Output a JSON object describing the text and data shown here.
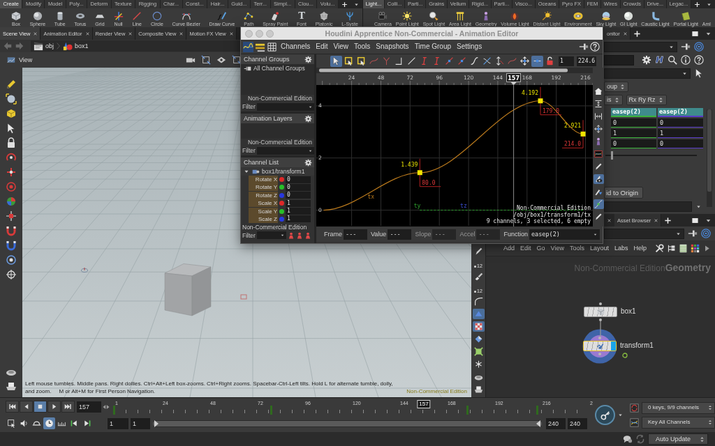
{
  "shelves": [
    {
      "tabs": [
        {
          "label": "Create",
          "selected": true
        },
        {
          "label": "Modify",
          "selected": false
        },
        {
          "label": "Model",
          "selected": false
        },
        {
          "label": "Poly...",
          "selected": false
        },
        {
          "label": "Deform",
          "selected": false
        },
        {
          "label": "Texture",
          "selected": false
        },
        {
          "label": "Rigging",
          "selected": false
        },
        {
          "label": "Char...",
          "selected": false
        },
        {
          "label": "Const...",
          "selected": false
        },
        {
          "label": "Hair...",
          "selected": false
        },
        {
          "label": "Guid...",
          "selected": false
        },
        {
          "label": "Terr...",
          "selected": false
        },
        {
          "label": "Simpl...",
          "selected": false
        },
        {
          "label": "Clou...",
          "selected": false
        },
        {
          "label": "Volu...",
          "selected": false
        }
      ],
      "tools": [
        {
          "label": "Box"
        },
        {
          "label": "Sphere"
        },
        {
          "label": "Tube"
        },
        {
          "label": "Torus"
        },
        {
          "label": "Grid"
        },
        {
          "label": "Null"
        },
        {
          "label": "Line"
        },
        {
          "label": "Circle"
        },
        {
          "label": "Curve Bezier"
        },
        {
          "label": "Draw Curve"
        },
        {
          "label": "Path"
        },
        {
          "label": "Spray Paint"
        },
        {
          "label": "Font",
          "glyph": "T"
        },
        {
          "label": "Platonic"
        },
        {
          "label": "L-Syste"
        }
      ]
    },
    {
      "tabs": [
        {
          "label": "Light...",
          "selected": true
        },
        {
          "label": "Colli...",
          "selected": false
        },
        {
          "label": "Parti...",
          "selected": false
        },
        {
          "label": "Grains",
          "selected": false
        },
        {
          "label": "Vellum",
          "selected": false
        },
        {
          "label": "Rigid...",
          "selected": false
        },
        {
          "label": "Parti...",
          "selected": false
        },
        {
          "label": "Visco...",
          "selected": false
        },
        {
          "label": "Oceans",
          "selected": false
        },
        {
          "label": "Pyro FX",
          "selected": false
        },
        {
          "label": "FEM",
          "selected": false
        },
        {
          "label": "Wires",
          "selected": false
        },
        {
          "label": "Crowds",
          "selected": false
        },
        {
          "label": "Drive...",
          "selected": false
        },
        {
          "label": "Legac...",
          "selected": false
        }
      ],
      "tools": [
        {
          "label": "Camera"
        },
        {
          "label": "Point Light"
        },
        {
          "label": "Spot Light"
        },
        {
          "label": "Area Light"
        },
        {
          "label": "Geometry"
        },
        {
          "label": "Volume Light"
        },
        {
          "label": "Distant Light"
        },
        {
          "label": "Environment"
        },
        {
          "label": "Sky Light"
        },
        {
          "label": "GI Light"
        },
        {
          "label": "Caustic Light"
        },
        {
          "label": "Portal Light"
        },
        {
          "label": "Aml"
        }
      ]
    }
  ],
  "pane_tabs": [
    {
      "label": "Scene View",
      "selected": true
    },
    {
      "label": "Animation Editor",
      "selected": false
    },
    {
      "label": "Render View",
      "selected": false
    },
    {
      "label": "Composite View",
      "selected": false
    },
    {
      "label": "Motion FX View",
      "selected": false
    }
  ],
  "path": [
    "obj",
    "box1"
  ],
  "viewport": {
    "title": "View",
    "hint": "Left mouse tumbles. Middle pans. Right dollies. Ctrl+Alt+Left box-zooms. Ctrl+Right zooms. Spacebar-Ctrl-Left tilts. Hold L for alternate tumble, dolly, and zoom.     M or Alt+M for First Person Navigation.",
    "edition": "Non-Commercial Edition",
    "strip_labels": [
      "12",
      "12"
    ],
    "side_tools": [
      {
        "on": false
      },
      {
        "on": false
      },
      {
        "on": false
      },
      {
        "on": false
      },
      {
        "on": false
      },
      {
        "on": true
      },
      {
        "on": true
      },
      {
        "on": false
      },
      {
        "on": false
      },
      {
        "on": false
      },
      {
        "on": false
      },
      {
        "on": false
      }
    ]
  },
  "animation_editor": {
    "title": "Houdini Apprentice Non-Commercial - Animation Editor",
    "menu": [
      "Channels",
      "Edit",
      "View",
      "Tools",
      "Snapshots",
      "Time Group",
      "Settings"
    ],
    "channel_groups": {
      "title": "Channel Groups",
      "items": [
        "All Channel Groups"
      ],
      "edition": "Non-Commercial Edition",
      "filter": "Filter"
    },
    "animation_layers": {
      "title": "Animation Layers",
      "edition": "Non-Commercial Edition",
      "filter": "Filter"
    },
    "channel_list": {
      "title": "Channel List",
      "node": "box1/transform1",
      "channels": [
        {
          "name": "Rotate X",
          "color": "#e02828",
          "value": "0"
        },
        {
          "name": "Rotate Y",
          "color": "#28c028",
          "value": "0"
        },
        {
          "name": "Rotate Z",
          "color": "#2838e0",
          "value": "0"
        },
        {
          "name": "Scale X",
          "color": "#e02828",
          "value": "1"
        },
        {
          "name": "Scale Y",
          "color": "#28c028",
          "value": "1"
        },
        {
          "name": "Scale Z",
          "color": "#2838e0",
          "value": "1"
        }
      ],
      "edition": "Non-Commercial Edition",
      "filter": "Filter"
    },
    "toolbar": [
      {
        "on": true
      },
      {
        "on": false
      },
      {
        "on": false
      },
      {
        "on": false
      },
      {
        "on": false
      },
      {
        "on": false
      },
      {
        "on": false
      },
      {
        "on": false
      },
      {
        "on": false
      },
      {
        "on": false
      },
      {
        "on": false
      },
      {
        "on": false
      },
      {
        "on": false
      },
      {
        "on": false
      },
      {
        "on": false
      },
      {
        "on": false
      },
      {
        "on": true
      },
      {
        "on": false
      }
    ],
    "range": [
      "1",
      "224.6"
    ],
    "graph": {
      "chart_data": {
        "type": "line",
        "x": [
          1,
          80,
          179,
          214
        ],
        "series": [
          {
            "name": "tx",
            "color": "#b8781c",
            "line_style": "solid",
            "values": [
              0,
              1.439,
              4.192,
              2.921
            ]
          },
          {
            "name": "ty",
            "color": "#2e9e2e",
            "line_style": "dashed",
            "values": [
              null,
              0,
              0,
              0
            ]
          },
          {
            "name": "tz",
            "color": "#3a4ed0",
            "values": [
              null,
              null,
              null,
              null
            ]
          }
        ],
        "xlim": [
          -5,
          222
        ],
        "ylim": [
          -0.6,
          4.8
        ],
        "xticks": [
          24,
          48,
          72,
          96,
          120,
          144,
          168,
          192,
          216
        ],
        "yticks": [
          0,
          2,
          4
        ],
        "grid": true,
        "ref_lines": [
          {
            "axis": "x",
            "value": 157,
            "label": "157"
          }
        ],
        "annotations": [
          {
            "x": 80,
            "y": 1.439,
            "text": "1.439"
          },
          {
            "x": 179,
            "y": 4.192,
            "text": "4.192"
          },
          {
            "x": 214,
            "y": 2.921,
            "text": "2.921"
          }
        ]
      },
      "key_frames": [
        "80.0",
        "179.0",
        "214.0"
      ],
      "info": [
        "Non-Commercial Edition",
        "/obj/box1/transform1/tx",
        "9 channels, 3 selected, 6 empty"
      ]
    },
    "side_tools": [
      {
        "on": false
      },
      {
        "on": false
      },
      {
        "on": false
      },
      {
        "on": false
      },
      {
        "on": false
      },
      {
        "on": false
      },
      {
        "on": false
      },
      {
        "on": true
      },
      {
        "on": false
      },
      {
        "on": true
      },
      {
        "on": false
      }
    ],
    "fields": [
      {
        "label": "Frame",
        "value": "---",
        "disabled": false
      },
      {
        "label": "Value",
        "value": "---",
        "disabled": false
      },
      {
        "label": "Slope",
        "value": "---",
        "disabled": true
      },
      {
        "label": "Accel",
        "value": "---",
        "disabled": true
      },
      {
        "label": "Function",
        "value": "easep(2)",
        "disabled": false
      }
    ]
  },
  "parameters": {
    "tab": "onitor",
    "logo": "H",
    "menus": [
      "oup",
      "is",
      "Rx Ry Rz"
    ],
    "table": {
      "columns": [
        {
          "label": "easep(2)",
          "color": "#3cb43c"
        },
        {
          "label": "easep(2)",
          "color": "#5a3cc8"
        }
      ],
      "rows": [
        [
          "0",
          "0"
        ],
        [
          "1",
          "1"
        ],
        [
          "0",
          "0"
        ]
      ]
    },
    "slider": {
      "level": 0.07
    },
    "button": "id to Origin"
  },
  "network": {
    "tabs": [
      {
        "label": "Asset Browser",
        "selected": false
      }
    ],
    "menu": [
      "Add",
      "Edit",
      "Go",
      "View",
      "Tools",
      "Layout",
      "Labs",
      "Help"
    ],
    "edition": "Non-Commercial Edition",
    "context": "Geometry",
    "nodes": [
      {
        "name": "box1",
        "selected": false,
        "display": false
      },
      {
        "name": "transform1",
        "selected": true,
        "display": true
      }
    ]
  },
  "timeline": {
    "playing": false,
    "realtime": true,
    "frame": "157",
    "ruler_labels": [
      "1",
      "24",
      "48",
      "72",
      "96",
      "120",
      "144",
      "168",
      "192",
      "216",
      "2"
    ],
    "marker": "157",
    "playhead": {
      "level": 0.653
    },
    "range": [
      "1",
      "1",
      "240",
      "240"
    ],
    "range_bar": {
      "level": 1
    },
    "keys_status": "0 keys, 9/9 channels",
    "key_mode": "Key All Channels"
  },
  "status_bar": {
    "update_mode": "Auto Update"
  }
}
